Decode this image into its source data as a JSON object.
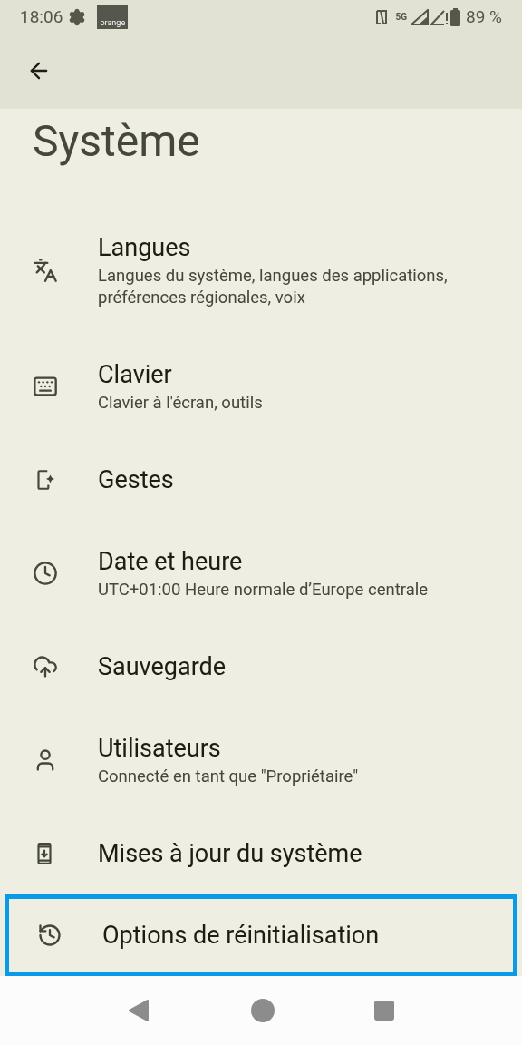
{
  "status_bar": {
    "time": "18:06",
    "carrier_logo": "orange",
    "network": "5G",
    "battery": "89 %"
  },
  "title": "Système",
  "items": [
    {
      "kind": "translate",
      "title": "Langues",
      "subtitle": "Langues du système, langues des applications, préférences régionales, voix",
      "highlighted": false
    },
    {
      "kind": "keyboard",
      "title": "Clavier",
      "subtitle": "Clavier à l'écran, outils",
      "highlighted": false
    },
    {
      "kind": "gestures",
      "title": "Gestes",
      "highlighted": false
    },
    {
      "kind": "clock",
      "title": "Date et heure",
      "subtitle": "UTC+01:00 Heure normale d’Europe centrale",
      "highlighted": false
    },
    {
      "kind": "cloud",
      "title": "Sauvegarde",
      "highlighted": false
    },
    {
      "kind": "user",
      "title": "Utilisateurs",
      "subtitle": "Connecté en tant que \"Propriétaire\"",
      "highlighted": false
    },
    {
      "kind": "update",
      "title": "Mises à jour du système",
      "highlighted": false
    },
    {
      "kind": "history",
      "title": "Options de réinitialisation",
      "highlighted": true
    }
  ]
}
